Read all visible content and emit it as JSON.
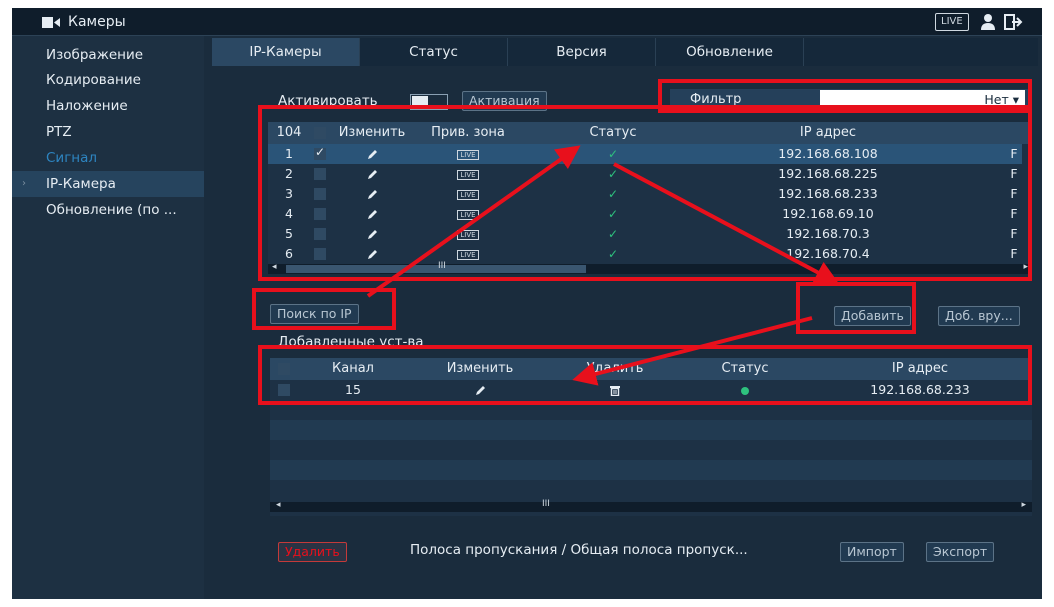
{
  "topbar": {
    "title": "Камеры",
    "live": "LIVE"
  },
  "sidebar": {
    "items": [
      {
        "label": "Изображение"
      },
      {
        "label": "Кодирование"
      },
      {
        "label": "Наложение"
      },
      {
        "label": "PTZ"
      },
      {
        "label": "Сигнал"
      },
      {
        "label": "IP-Камера"
      },
      {
        "label": "Обновление (по ..."
      }
    ]
  },
  "tabs": [
    {
      "label": "IP-Камеры"
    },
    {
      "label": "Статус"
    },
    {
      "label": "Версия"
    },
    {
      "label": "Обновление"
    }
  ],
  "activation": {
    "label": "Активировать",
    "button": "Активация"
  },
  "filter": {
    "label": "Фильтр",
    "value": "Нет ▾"
  },
  "found_table": {
    "count": "104",
    "columns": [
      "Изменить",
      "Прив. зона",
      "Статус",
      "IP адрес"
    ],
    "rows": [
      {
        "num": "1",
        "ip": "192.168.68.108"
      },
      {
        "num": "2",
        "ip": "192.168.68.225"
      },
      {
        "num": "3",
        "ip": "192.168.68.233"
      },
      {
        "num": "4",
        "ip": "192.168.69.10"
      },
      {
        "num": "5",
        "ip": "192.168.70.3"
      },
      {
        "num": "6",
        "ip": "192.168.70.4"
      }
    ],
    "row_live": "LIVE",
    "truncated_col": "F"
  },
  "buttons": {
    "search_ip": "Поиск по IP",
    "add": "Добавить",
    "add_manual": "Доб. вру...",
    "delete": "Удалить",
    "import": "Импорт",
    "export": "Экспорт"
  },
  "added": {
    "title": "Добавленные уст-ва",
    "columns": [
      "Канал",
      "Изменить",
      "Удалить",
      "Статус",
      "IP адрес"
    ],
    "rows": [
      {
        "channel": "15",
        "ip": "192.168.68.233"
      }
    ]
  },
  "bandwidth": "Полоса пропускания / Общая полоса пропуск...",
  "scroll_glyph": "III",
  "colors": {
    "highlight": "#e8101c",
    "status_ok": "#2ec27e",
    "accent": "#2d84c0"
  }
}
